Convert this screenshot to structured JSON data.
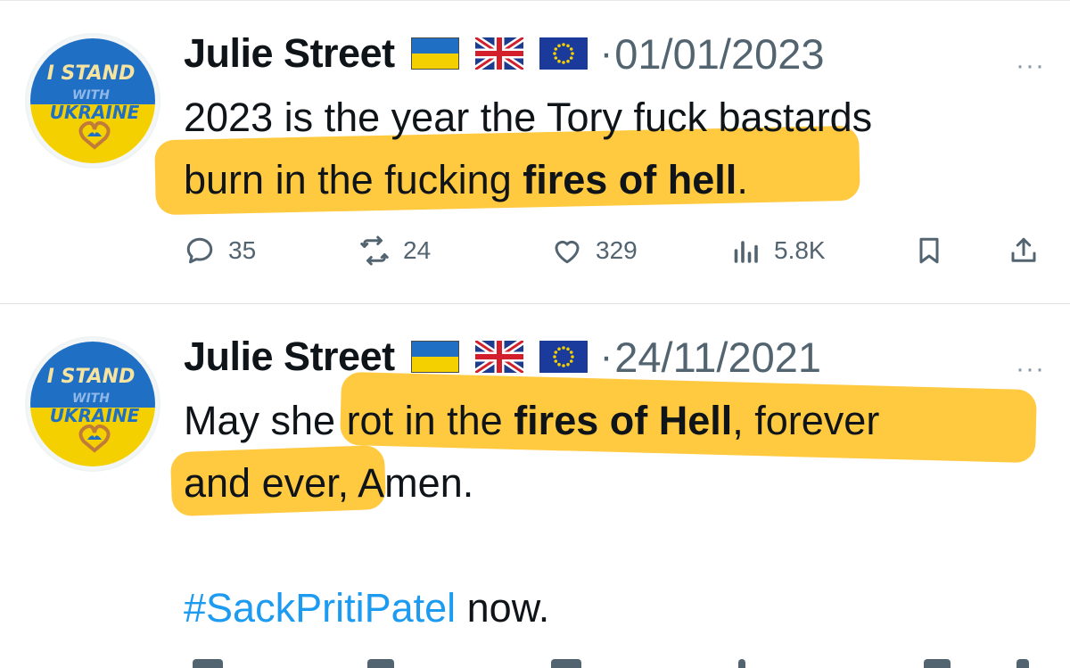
{
  "tweets": [
    {
      "name": "Julie Street",
      "date": "01/01/2023",
      "separator": "·",
      "more": "···",
      "avatar_text": [
        "I STAND",
        "WITH",
        "UKRAINE"
      ],
      "text": {
        "line1": "2023 is the year the Tory fuck bastards",
        "line2_a": "burn in the fucking ",
        "line2_b": "fires of hell",
        "line2_c": "."
      },
      "actions": {
        "replies": "35",
        "retweets": "24",
        "likes": "329",
        "views": "5.8K"
      }
    },
    {
      "name": "Julie Street",
      "date": "24/11/2021",
      "separator": "·",
      "more": "···",
      "avatar_text": [
        "I STAND",
        "WITH",
        "UKRAINE"
      ],
      "text": {
        "line1_a": "May she rot in the ",
        "line1_b": "fires of Hell",
        "line1_c": ", forever",
        "line2": "and ever, Amen.",
        "hashtag": "#SackPritiPatel",
        "line3_rest": " now."
      }
    }
  ],
  "colors": {
    "highlight": "#ffb700",
    "secondary_text": "#536471",
    "hashtag": "#1d9bf0",
    "ukraine_blue": "#1f6fc5",
    "ukraine_yellow": "#f5d000"
  },
  "icons": [
    "reply-icon",
    "retweet-icon",
    "like-icon",
    "views-icon",
    "bookmark-icon",
    "share-icon",
    "ukraine-flag-icon",
    "uk-flag-icon",
    "eu-flag-icon",
    "more-icon"
  ]
}
